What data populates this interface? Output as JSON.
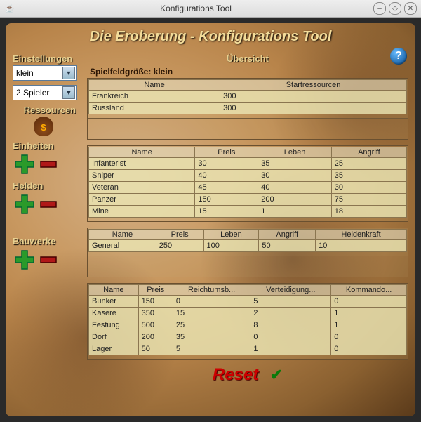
{
  "window": {
    "title": "Konfigurations Tool"
  },
  "app_title": "Die Eroberung - Konfigurations Tool",
  "sidebar": {
    "settings_label": "Einstellungen",
    "size_value": "klein",
    "players_value": "2 Spieler",
    "resources_label": "Ressourcen",
    "units_label": "Einheiten",
    "heroes_label": "Helden",
    "buildings_label": "Bauwerke"
  },
  "overview": {
    "label": "Übersicht",
    "fieldsize": "Spielfeldgröße: klein"
  },
  "players": {
    "headers": [
      "Name",
      "Startressourcen"
    ],
    "rows": [
      [
        "Frankreich",
        "300"
      ],
      [
        "Russland",
        "300"
      ]
    ]
  },
  "units": {
    "headers": [
      "Name",
      "Preis",
      "Leben",
      "Angriff"
    ],
    "rows": [
      [
        "Infanterist",
        "30",
        "35",
        "25"
      ],
      [
        "Sniper",
        "40",
        "30",
        "35"
      ],
      [
        "Veteran",
        "45",
        "40",
        "30"
      ],
      [
        "Panzer",
        "150",
        "200",
        "75"
      ],
      [
        "Mine",
        "15",
        "1",
        "18"
      ]
    ]
  },
  "heroes": {
    "headers": [
      "Name",
      "Preis",
      "Leben",
      "Angriff",
      "Heldenkraft"
    ],
    "rows": [
      [
        "General",
        "250",
        "100",
        "50",
        "10"
      ]
    ]
  },
  "buildings": {
    "headers": [
      "Name",
      "Preis",
      "Reichtumsb...",
      "Verteidigung...",
      "Kommando..."
    ],
    "rows": [
      [
        "Bunker",
        "150",
        "0",
        "5",
        "0"
      ],
      [
        "Kasere",
        "350",
        "15",
        "2",
        "1"
      ],
      [
        "Festung",
        "500",
        "25",
        "8",
        "1"
      ],
      [
        "Dorf",
        "200",
        "35",
        "0",
        "0"
      ],
      [
        "Lager",
        "50",
        "5",
        "1",
        "0"
      ]
    ]
  },
  "footer": {
    "reset": "Reset"
  }
}
